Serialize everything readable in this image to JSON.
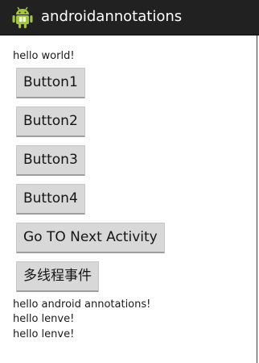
{
  "action_bar": {
    "title": "androidannotations",
    "icon": "android-robot-icon",
    "background": "#212121",
    "icon_color": "#a4c639"
  },
  "main": {
    "greeting": "hello world!",
    "buttons": [
      {
        "label": "Button1"
      },
      {
        "label": "Button2"
      },
      {
        "label": "Button3"
      },
      {
        "label": "Button4"
      },
      {
        "label": "Go TO Next Activity"
      },
      {
        "label": "多线程事件"
      }
    ],
    "messages": [
      "hello android annotations!",
      "hello lenve!",
      "hello lenve!"
    ]
  }
}
